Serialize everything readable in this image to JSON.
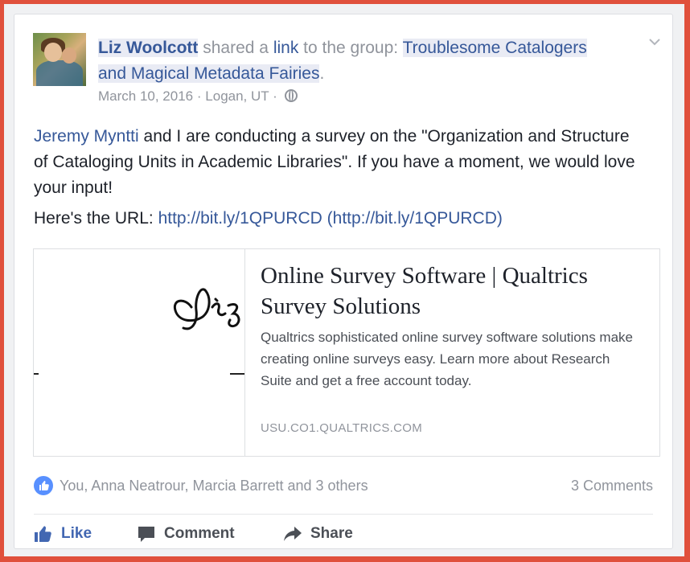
{
  "post": {
    "author": "Liz Woolcott",
    "shared_text": " shared a ",
    "link_word": "link",
    "to_group_text": " to the group: ",
    "group_name": "Troublesome Catalogers and Magical Metadata Fairies",
    "group_suffix": ".",
    "date": "March 10, 2016",
    "location": "Logan, UT",
    "separator": "·",
    "mention": "Jeremy Myntti",
    "body_rest": " and I are conducting a survey on the \"Organization and Structure of Cataloging Units in Academic Libraries\". If you have a moment, we would love your input!",
    "url_prefix": "Here's the URL: ",
    "url": "http://bit.ly/1QPURCD",
    "url_paren": "(http://bit.ly/1QPURCD)"
  },
  "attachment": {
    "title": "Online Survey Software | Qualtrics Survey Solutions",
    "description": "Qualtrics sophisticated online survey software solutions make creating online surveys easy. Learn more about Research Suite and get a free account today.",
    "domain": "USU.CO1.QUALTRICS.COM"
  },
  "reactions": {
    "likers": "You, Anna Neatrour, Marcia Barrett and 3 others",
    "comments": "3 Comments"
  },
  "actions": {
    "like": "Like",
    "comment": "Comment",
    "share": "Share"
  },
  "icons": {
    "avatar": "profile-photo",
    "globe": "globe-icon",
    "chevron": "chevron-down-icon",
    "like_badge": "thumbs-up-icon",
    "like": "thumbs-up-icon",
    "comment": "comment-icon",
    "share": "share-arrow-icon"
  },
  "colors": {
    "frame": "#e0503c",
    "link": "#365899",
    "meta": "#90949c",
    "text": "#1d2129",
    "like_active": "#4267b2"
  }
}
